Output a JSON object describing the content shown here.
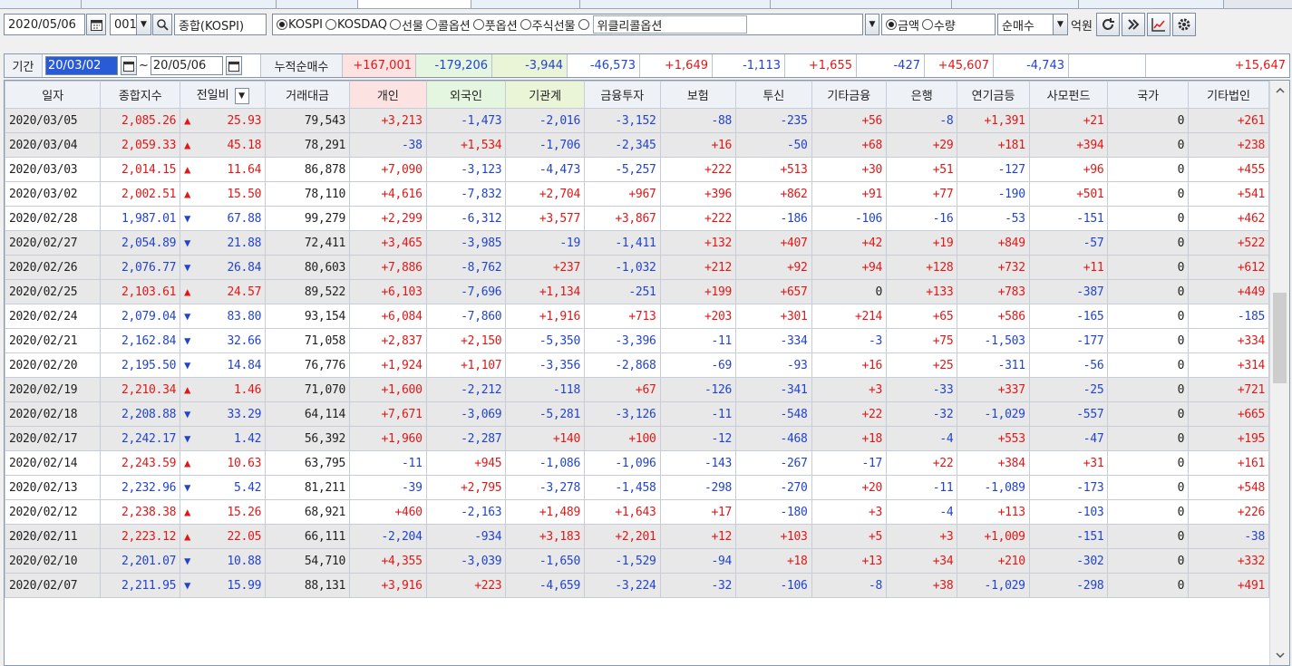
{
  "toolbar": {
    "date": "2020/05/06",
    "code": "001",
    "index_name": "종합(KOSPI)",
    "markets": [
      {
        "label": "KOSPI",
        "selected": true
      },
      {
        "label": "KOSDAQ",
        "selected": false
      },
      {
        "label": "선물",
        "selected": false
      },
      {
        "label": "콜옵션",
        "selected": false
      },
      {
        "label": "풋옵션",
        "selected": false
      },
      {
        "label": "주식선물",
        "selected": false
      },
      {
        "label": "",
        "selected": false
      }
    ],
    "weekly_option": "위클리콜옵션",
    "measure": [
      {
        "label": "금액",
        "selected": true
      },
      {
        "label": "수량",
        "selected": false
      }
    ],
    "trade_type": "순매수",
    "unit": "억원"
  },
  "summary": {
    "period_label": "기간",
    "from": "20/03/02",
    "tilde": "~",
    "to": "20/05/06",
    "cum_label": "누적순매수",
    "values": [
      "+167,001",
      "-179,206",
      "-3,944",
      "-46,573",
      "+1,649",
      "-1,113",
      "+1,655",
      "-427",
      "+45,607",
      "-4,743",
      "",
      "+15,647"
    ]
  },
  "columns": [
    "일자",
    "종합지수",
    "전일비",
    "거래대금",
    "개인",
    "외국인",
    "기관계",
    "금융투자",
    "보험",
    "투신",
    "기타금융",
    "은행",
    "연기금등",
    "사모펀드",
    "국가",
    "기타법인"
  ],
  "rows": [
    {
      "date": "2020/03/05",
      "index": "2,085.26",
      "dir": "up",
      "chg": "25.93",
      "vol": "79,543",
      "v": [
        "+3,213",
        "-1,473",
        "-2,016",
        "-3,152",
        "-88",
        "-235",
        "+56",
        "-8",
        "+1,391",
        "+21",
        "0",
        "+261"
      ],
      "shade": true
    },
    {
      "date": "2020/03/04",
      "index": "2,059.33",
      "dir": "up",
      "chg": "45.18",
      "vol": "78,291",
      "v": [
        "-38",
        "+1,534",
        "-1,706",
        "-2,345",
        "+16",
        "-50",
        "+68",
        "+29",
        "+181",
        "+394",
        "0",
        "+238"
      ],
      "shade": true
    },
    {
      "date": "2020/03/03",
      "index": "2,014.15",
      "dir": "up",
      "chg": "11.64",
      "vol": "86,878",
      "v": [
        "+7,090",
        "-3,123",
        "-4,473",
        "-5,257",
        "+222",
        "+513",
        "+30",
        "+51",
        "-127",
        "+96",
        "0",
        "+455"
      ],
      "shade": false
    },
    {
      "date": "2020/03/02",
      "index": "2,002.51",
      "dir": "up",
      "chg": "15.50",
      "vol": "78,110",
      "v": [
        "+4,616",
        "-7,832",
        "+2,704",
        "+967",
        "+396",
        "+862",
        "+91",
        "+77",
        "-190",
        "+501",
        "0",
        "+541"
      ],
      "shade": false
    },
    {
      "date": "2020/02/28",
      "index": "1,987.01",
      "dir": "dn",
      "chg": "67.88",
      "vol": "99,279",
      "v": [
        "+2,299",
        "-6,312",
        "+3,577",
        "+3,867",
        "+222",
        "-186",
        "-106",
        "-16",
        "-53",
        "-151",
        "0",
        "+462"
      ],
      "shade": false
    },
    {
      "date": "2020/02/27",
      "index": "2,054.89",
      "dir": "dn",
      "chg": "21.88",
      "vol": "72,411",
      "v": [
        "+3,465",
        "-3,985",
        "-19",
        "-1,411",
        "+132",
        "+407",
        "+42",
        "+19",
        "+849",
        "-57",
        "0",
        "+522"
      ],
      "shade": true
    },
    {
      "date": "2020/02/26",
      "index": "2,076.77",
      "dir": "dn",
      "chg": "26.84",
      "vol": "80,603",
      "v": [
        "+7,886",
        "-8,762",
        "+237",
        "-1,032",
        "+212",
        "+92",
        "+94",
        "+128",
        "+732",
        "+11",
        "0",
        "+612"
      ],
      "shade": true
    },
    {
      "date": "2020/02/25",
      "index": "2,103.61",
      "dir": "up",
      "chg": "24.57",
      "vol": "89,522",
      "v": [
        "+6,103",
        "-7,696",
        "+1,134",
        "-251",
        "+199",
        "+657",
        "0",
        "+133",
        "+783",
        "-387",
        "0",
        "+449"
      ],
      "shade": true
    },
    {
      "date": "2020/02/24",
      "index": "2,079.04",
      "dir": "dn",
      "chg": "83.80",
      "vol": "93,154",
      "v": [
        "+6,084",
        "-7,860",
        "+1,916",
        "+713",
        "+203",
        "+301",
        "+214",
        "+65",
        "+586",
        "-165",
        "0",
        "-185"
      ],
      "shade": false
    },
    {
      "date": "2020/02/21",
      "index": "2,162.84",
      "dir": "dn",
      "chg": "32.66",
      "vol": "71,058",
      "v": [
        "+2,837",
        "+2,150",
        "-5,350",
        "-3,396",
        "-11",
        "-334",
        "-3",
        "+75",
        "-1,503",
        "-177",
        "0",
        "+334"
      ],
      "shade": false
    },
    {
      "date": "2020/02/20",
      "index": "2,195.50",
      "dir": "dn",
      "chg": "14.84",
      "vol": "76,776",
      "v": [
        "+1,924",
        "+1,107",
        "-3,356",
        "-2,868",
        "-69",
        "-93",
        "+16",
        "+25",
        "-311",
        "-56",
        "0",
        "+314"
      ],
      "shade": false
    },
    {
      "date": "2020/02/19",
      "index": "2,210.34",
      "dir": "up",
      "chg": "1.46",
      "vol": "71,070",
      "v": [
        "+1,600",
        "-2,212",
        "-118",
        "+67",
        "-126",
        "-341",
        "+3",
        "-33",
        "+337",
        "-25",
        "0",
        "+721"
      ],
      "shade": true
    },
    {
      "date": "2020/02/18",
      "index": "2,208.88",
      "dir": "dn",
      "chg": "33.29",
      "vol": "64,114",
      "v": [
        "+7,671",
        "-3,069",
        "-5,281",
        "-3,126",
        "-11",
        "-548",
        "+22",
        "-32",
        "-1,029",
        "-557",
        "0",
        "+665"
      ],
      "shade": true
    },
    {
      "date": "2020/02/17",
      "index": "2,242.17",
      "dir": "dn",
      "chg": "1.42",
      "vol": "56,392",
      "v": [
        "+1,960",
        "-2,287",
        "+140",
        "+100",
        "-12",
        "-468",
        "+18",
        "-4",
        "+553",
        "-47",
        "0",
        "+195"
      ],
      "shade": true
    },
    {
      "date": "2020/02/14",
      "index": "2,243.59",
      "dir": "up",
      "chg": "10.63",
      "vol": "63,795",
      "v": [
        "-11",
        "+945",
        "-1,086",
        "-1,096",
        "-143",
        "-267",
        "-17",
        "+22",
        "+384",
        "+31",
        "0",
        "+161"
      ],
      "shade": false
    },
    {
      "date": "2020/02/13",
      "index": "2,232.96",
      "dir": "dn",
      "chg": "5.42",
      "vol": "81,211",
      "v": [
        "-39",
        "+2,795",
        "-3,278",
        "-1,458",
        "-298",
        "-270",
        "+20",
        "-11",
        "-1,089",
        "-173",
        "0",
        "+548"
      ],
      "shade": false
    },
    {
      "date": "2020/02/12",
      "index": "2,238.38",
      "dir": "up",
      "chg": "15.26",
      "vol": "68,921",
      "v": [
        "+460",
        "-2,163",
        "+1,489",
        "+1,643",
        "+17",
        "-180",
        "+3",
        "-4",
        "+113",
        "-103",
        "0",
        "+226"
      ],
      "shade": false
    },
    {
      "date": "2020/02/11",
      "index": "2,223.12",
      "dir": "up",
      "chg": "22.05",
      "vol": "66,111",
      "v": [
        "-2,204",
        "-934",
        "+3,183",
        "+2,201",
        "+12",
        "+103",
        "+5",
        "+3",
        "+1,009",
        "-151",
        "0",
        "-38"
      ],
      "shade": true
    },
    {
      "date": "2020/02/10",
      "index": "2,201.07",
      "dir": "dn",
      "chg": "10.88",
      "vol": "54,710",
      "v": [
        "+4,355",
        "-3,039",
        "-1,650",
        "-1,529",
        "-94",
        "+18",
        "+13",
        "+34",
        "+210",
        "-302",
        "0",
        "+332"
      ],
      "shade": true
    },
    {
      "date": "2020/02/07",
      "index": "2,211.95",
      "dir": "dn",
      "chg": "15.99",
      "vol": "88,131",
      "v": [
        "+3,916",
        "+223",
        "-4,659",
        "-3,224",
        "-32",
        "-106",
        "-8",
        "+38",
        "-1,029",
        "-298",
        "0",
        "+491"
      ],
      "shade": true
    }
  ],
  "colors": {
    "up": "#e01818",
    "down": "#2244cc",
    "individual_header": "#fde2e2",
    "foreign_header": "#e4f6e0",
    "inst_header": "#eaf4d6"
  }
}
